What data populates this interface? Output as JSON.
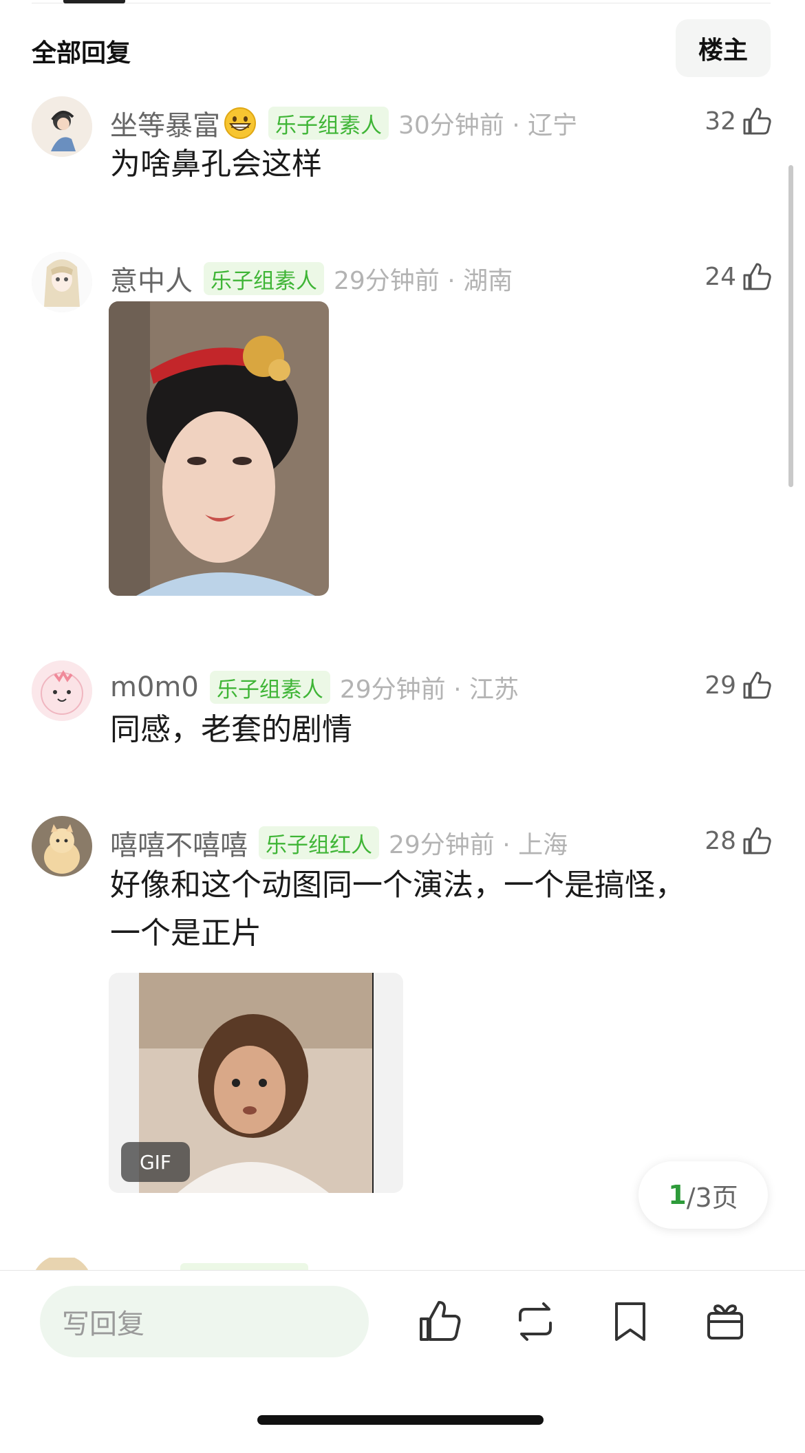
{
  "header": {
    "title": "全部回复",
    "filter_button": "楼主"
  },
  "comments": [
    {
      "username": "坐等暴富",
      "emoji": "grinning-face",
      "badge": "乐子组素人",
      "time": "30分钟前 · 辽宁",
      "likes": "32",
      "text": "为啥鼻孔会这样"
    },
    {
      "username": "意中人",
      "badge": "乐子组素人",
      "time": "29分钟前 · 湖南",
      "likes": "24"
    },
    {
      "username": "m0m0",
      "badge": "乐子组素人",
      "time": "29分钟前 · 江苏",
      "likes": "29",
      "text": "同感，老套的剧情"
    },
    {
      "username": "嘻嘻不嘻嘻",
      "badge": "乐子组红人",
      "time": "29分钟前 · 上海",
      "likes": "28",
      "text_line1": "好像和这个动图同一个演法，一个是搞怪，",
      "text_line2": "一个是正片",
      "gif_label": "GIF"
    }
  ],
  "pager": {
    "current": "1",
    "total": "/3页"
  },
  "bottom_bar": {
    "reply_placeholder": "写回复"
  },
  "colors": {
    "badge_green": "#3fb536",
    "badge_bg": "#ecf8e6",
    "accent": "#2e9b3a"
  },
  "icons": [
    "thumbs-up-icon",
    "repost-icon",
    "bookmark-icon",
    "gift-icon"
  ]
}
